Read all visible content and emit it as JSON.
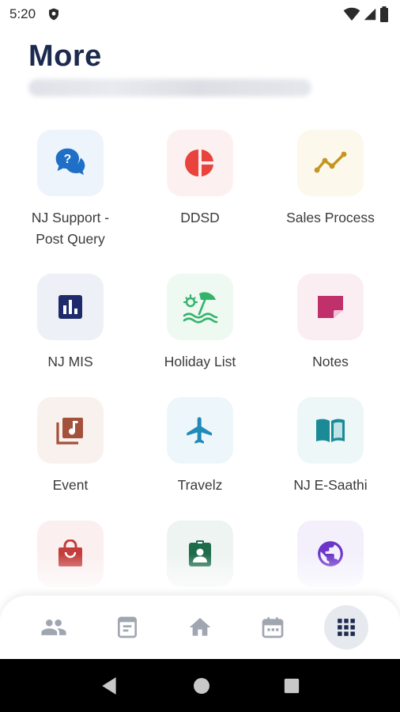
{
  "status_bar": {
    "time": "5:20",
    "icons": [
      "shield-icon",
      "wifi-icon",
      "signal-icon",
      "battery-icon"
    ]
  },
  "header": {
    "title": "More"
  },
  "tiles": [
    {
      "label": "NJ Support -\nPost Query",
      "icon": "chat-question-icon",
      "bg": "#eef4fb",
      "color": "#1e6fc5"
    },
    {
      "label": "DDSD",
      "icon": "pie-chart-icon",
      "bg": "#fdf0f0",
      "color": "#e8433c"
    },
    {
      "label": "Sales Process",
      "icon": "trend-line-icon",
      "bg": "#fcf8ec",
      "color": "#c49520"
    },
    {
      "label": "NJ MIS",
      "icon": "bar-chart-icon",
      "bg": "#eef0f7",
      "color": "#1f2a6b"
    },
    {
      "label": "Holiday List",
      "icon": "beach-umbrella-icon",
      "bg": "#eef9f2",
      "color": "#33b36a"
    },
    {
      "label": "Notes",
      "icon": "note-icon",
      "bg": "#fbeef3",
      "color": "#c0306b"
    },
    {
      "label": "Event",
      "icon": "music-library-icon",
      "bg": "#f9f1ee",
      "color": "#a3513a"
    },
    {
      "label": "Travelz",
      "icon": "airplane-icon",
      "bg": "#edf6fa",
      "color": "#1f8bb8"
    },
    {
      "label": "NJ E-Saathi",
      "icon": "book-icon",
      "bg": "#edf7f8",
      "color": "#1a8a96"
    },
    {
      "label": "",
      "icon": "shopping-bag-icon",
      "bg": "#fbefef",
      "color": "#c43c3c"
    },
    {
      "label": "",
      "icon": "id-badge-icon",
      "bg": "#eef4f1",
      "color": "#1d6b4a"
    },
    {
      "label": "",
      "icon": "globe-icon",
      "bg": "#f3f0fb",
      "color": "#6a35c8"
    }
  ],
  "bottom_nav": {
    "items": [
      "people-icon",
      "document-icon",
      "home-icon",
      "calendar-icon",
      "grid-icon"
    ],
    "active_index": 4,
    "inactive_color": "#a0a6b0",
    "active_color": "#1b2a4e"
  }
}
